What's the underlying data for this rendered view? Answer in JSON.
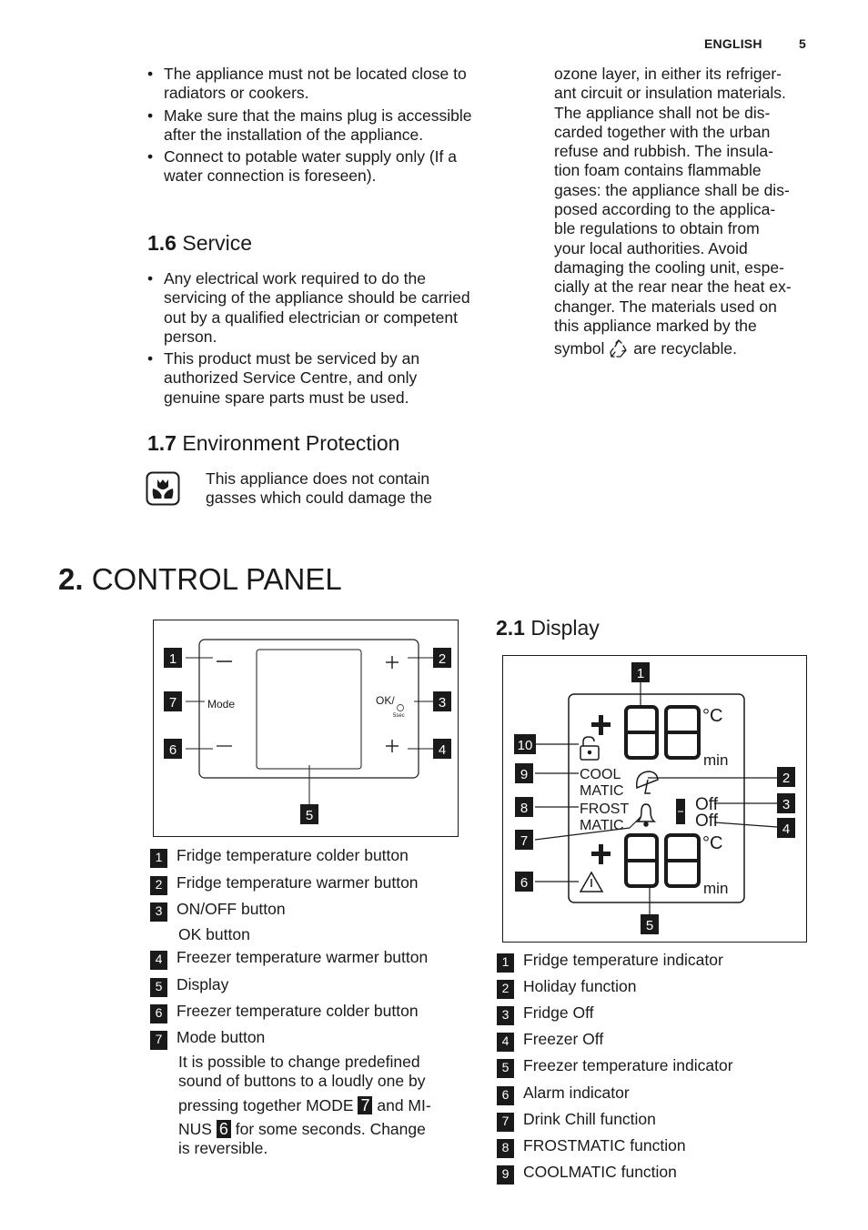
{
  "header": {
    "language": "ENGLISH",
    "page_number": "5"
  },
  "left_column": {
    "bullets_top": [
      "The appliance must not be located close to radiators or cookers.",
      "Make sure that the mains plug is accessible after the installation of the appliance.",
      "Connect to potable water supply only (If a water connection is foreseen)."
    ],
    "section_1_6": {
      "number": "1.6",
      "title": "Service",
      "bullets": [
        "Any electrical work required to do the servicing of the appliance should be carried out by a qualified electrician or competent person.",
        "This product must be serviced by an authorized Service Centre, and only genuine spare parts must be used."
      ]
    },
    "section_1_7": {
      "number": "1.7",
      "title": "Environment Protection",
      "icon": "tulip-eco-icon",
      "text": "This appliance does not contain gasses which could damage the"
    }
  },
  "right_column": {
    "continued_text_lines": [
      "ozone layer, in either its refriger-",
      "ant circuit or insulation materials.",
      "The appliance shall not be dis-",
      "carded together with the urban",
      "refuse and rubbish. The insula-",
      "tion foam contains flammable",
      "gases: the appliance shall be dis-",
      "posed according to the applica-",
      "ble regulations to obtain from",
      "your local authorities. Avoid",
      "damaging the cooling unit, espe-",
      "cially at the rear near the heat ex-",
      "changer. The materials used on",
      "this appliance marked by the"
    ],
    "last_line_before": "symbol",
    "last_line_icon": "recycle-icon",
    "last_line_after": "are recyclable."
  },
  "chapter_2": {
    "number": "2.",
    "title": "CONTROL PANEL",
    "panel_diagram": {
      "minus_symbol": "–",
      "plus_symbol": "+",
      "mode_label": "Mode",
      "ok_label": "OK/",
      "ok_sub": "5sec",
      "callouts": [
        "1",
        "2",
        "3",
        "4",
        "5",
        "6",
        "7"
      ]
    },
    "panel_legend": [
      {
        "num": "1",
        "label": "Fridge temperature colder button"
      },
      {
        "num": "2",
        "label": "Fridge temperature warmer button"
      },
      {
        "num": "3",
        "label": "ON/OFF button"
      },
      {
        "num": "",
        "label": "OK button"
      },
      {
        "num": "4",
        "label": "Freezer temperature warmer button"
      },
      {
        "num": "5",
        "label": "Display"
      },
      {
        "num": "6",
        "label": "Freezer temperature colder button"
      },
      {
        "num": "7",
        "label": "Mode button"
      }
    ],
    "mode_note": {
      "line1": "It is possible to change predefined",
      "line2": "sound of buttons to a loudly one by",
      "line3_before": "pressing together MODE",
      "line3_badge": "7",
      "line3_after": "and MI-",
      "line4_before": "NUS",
      "line4_badge": "6",
      "line4_after": "for some seconds. Change",
      "line5": "is reversible."
    },
    "section_2_1": {
      "number": "2.1",
      "title": "Display",
      "display_diagram": {
        "unit_celsius": "°C",
        "unit_min": "min",
        "cool_label_1": "COOL",
        "cool_label_2": "MATIC",
        "frost_label_1": "FROST",
        "frost_label_2": "MATIC",
        "off_1": "Off",
        "off_2": "Off",
        "callouts": [
          "1",
          "2",
          "3",
          "4",
          "5",
          "6",
          "7",
          "8",
          "9",
          "10"
        ]
      },
      "legend": [
        {
          "num": "1",
          "label": "Fridge temperature indicator"
        },
        {
          "num": "2",
          "label": "Holiday function"
        },
        {
          "num": "3",
          "label": "Fridge Off"
        },
        {
          "num": "4",
          "label": "Freezer Off"
        },
        {
          "num": "5",
          "label": "Freezer temperature indicator"
        },
        {
          "num": "6",
          "label": "Alarm indicator"
        },
        {
          "num": "7",
          "label": "Drink Chill function"
        },
        {
          "num": "8",
          "label": "FROSTMATIC function"
        },
        {
          "num": "9",
          "label": "COOLMATIC function"
        }
      ]
    }
  }
}
